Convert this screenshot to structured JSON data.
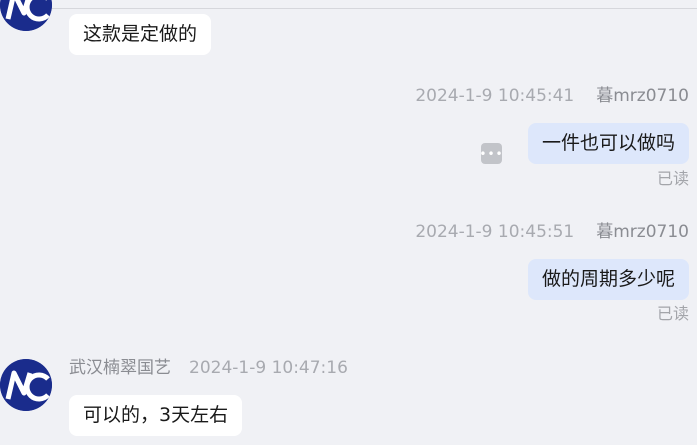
{
  "messages": [
    {
      "text": "这款是定做的"
    },
    {
      "time": "2024-1-9 10:45:41",
      "sender": "暮mrz0710",
      "text": "一件也可以做吗",
      "status": "已读"
    },
    {
      "time": "2024-1-9 10:45:51",
      "sender": "暮mrz0710",
      "text": "做的周期多少呢",
      "status": "已读"
    },
    {
      "sender": "武汉楠翠国艺",
      "time": "2024-1-9 10:47:16",
      "text": "可以的，3天左右"
    }
  ],
  "icons": {
    "avatar": "brand-logo-avatar",
    "more": "more-options-icon"
  },
  "colors": {
    "background": "#f0f1f5",
    "right_bubble": "#dde7fb",
    "left_bubble": "#ffffff",
    "avatar": "#1a2c8c"
  }
}
